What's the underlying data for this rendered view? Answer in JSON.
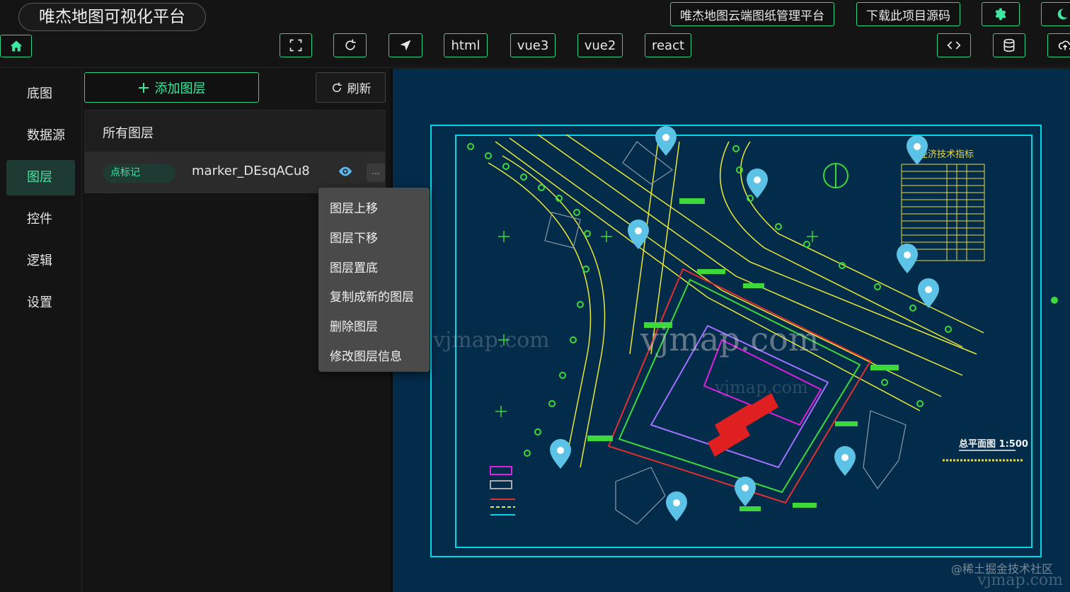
{
  "app": {
    "title": "唯杰地图可视化平台"
  },
  "header": {
    "links": [
      "唯杰地图云端图纸管理平台",
      "下载此项目源码"
    ],
    "frameworks": [
      "html",
      "vue3",
      "vue2",
      "react"
    ]
  },
  "nav": {
    "items": [
      "底图",
      "数据源",
      "图层",
      "控件",
      "逻辑",
      "设置"
    ],
    "active": "图层"
  },
  "panel": {
    "add_label": "添加图层",
    "refresh_label": "刷新",
    "list_title": "所有图层",
    "layer": {
      "tag": "点标记",
      "name": "marker_DEsqACu8",
      "more": "..."
    }
  },
  "menu": {
    "items": [
      "图层上移",
      "图层下移",
      "图层置底",
      "复制成新的图层",
      "删除图层",
      "修改图层信息"
    ]
  },
  "map": {
    "drawing_title": "总平面图 1:500",
    "table_title": "经济技术指标",
    "watermark": "vjmap.com",
    "credit": "@稀土掘金技术社区",
    "credit_site": "vjmap.com"
  },
  "colors": {
    "accent": "#2fd38a",
    "map_bg": "#032b4a",
    "marker": "#5cc3e6"
  }
}
